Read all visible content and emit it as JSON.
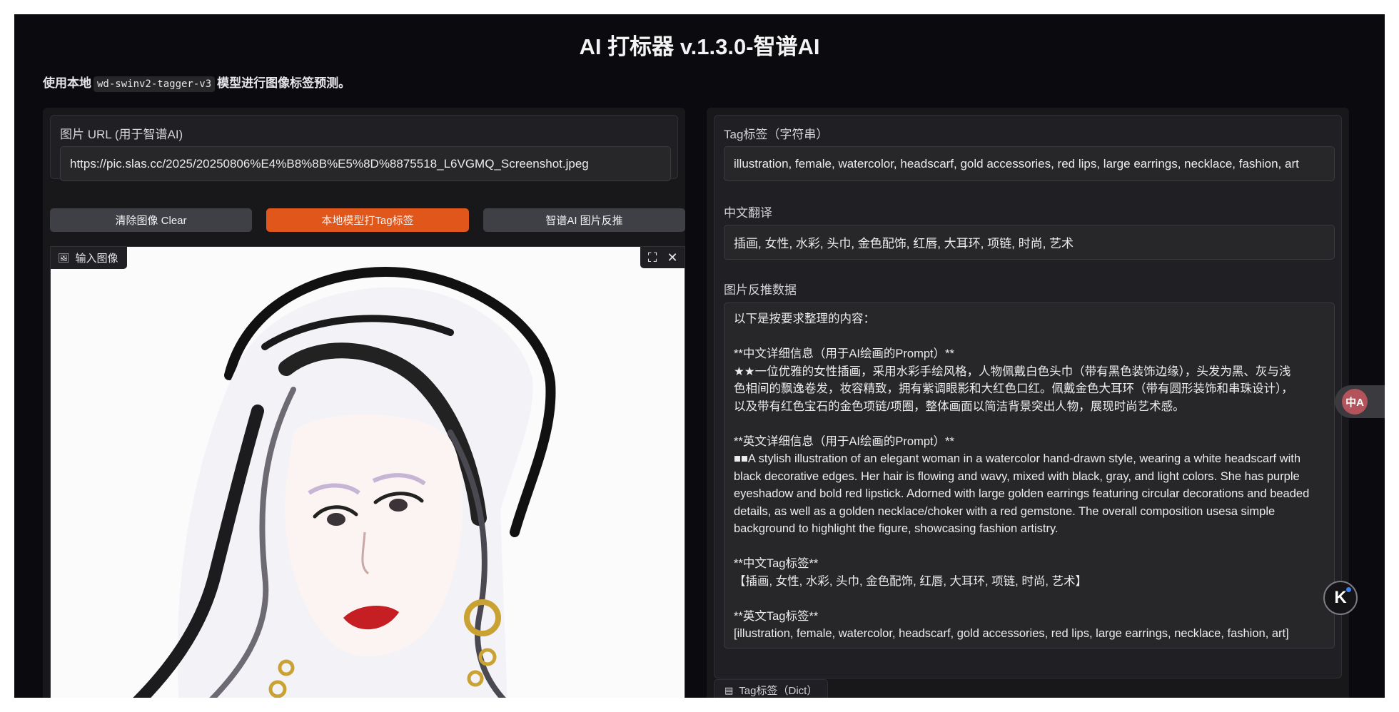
{
  "header": {
    "title": "AI 打标器 v.1.3.0-智谱AI",
    "desc_prefix": "使用本地",
    "desc_model": "wd-swinv2-tagger-v3",
    "desc_suffix": "模型进行图像标签预测。"
  },
  "left": {
    "url_label": "图片 URL (用于智谱AI)",
    "url_value": "https://pic.slas.cc/2025/20250806%E4%B8%8B%E5%8D%8875518_L6VGMQ_Screenshot.jpeg",
    "buttons": {
      "clear": "清除图像 Clear",
      "local_tag": "本地模型打Tag标签",
      "zhipu_reverse": "智谱AI 图片反推"
    },
    "image_label": "输入图像"
  },
  "right": {
    "tag_label": "Tag标签（字符串）",
    "tag_value": "illustration, female, watercolor, headscarf, gold accessories, red lips, large earrings, necklace, fashion, art",
    "cn_label": "中文翻译",
    "cn_value": "插画, 女性, 水彩, 头巾, 金色配饰, 红唇, 大耳环, 项链, 时尚, 艺术",
    "reverse_label": "图片反推数据",
    "reverse_lines": [
      "以下是按要求整理的内容：",
      "",
      "**中文详细信息（用于AI绘画的Prompt）**",
      "★★一位优雅的女性插画，采用水彩手绘风格，人物佩戴白色头巾（带有黑色装饰边缘），头发为黑、灰与浅",
      "色相间的飘逸卷发，妆容精致，拥有紫调眼影和大红色口红。佩戴金色大耳环（带有圆形装饰和串珠设计），",
      "以及带有红色宝石的金色项链/项圈，整体画面以简洁背景突出人物，展现时尚艺术感。",
      "",
      "**英文详细信息（用于AI绘画的Prompt）**",
      "■■A stylish illustration of an elegant woman in a watercolor hand-drawn style, wearing a white headscarf with",
      "black decorative edges. Her hair is flowing and wavy, mixed with black, gray, and light colors. She has purple",
      "eyeshadow and bold red lipstick. Adorned with large golden earrings featuring circular decorations and beaded",
      "details, as well as a golden necklace/choker with a red gemstone. The overall composition usesa simple",
      "background to highlight the figure, showcasing fashion artistry.",
      "",
      "**中文Tag标签**",
      "【插画, 女性, 水彩, 头巾, 金色配饰, 红唇, 大耳环, 项链, 时尚, 艺术】",
      "",
      "**英文Tag标签**",
      "[illustration, female, watercolor, headscarf, gold accessories, red lips, large earrings, necklace, fashion, art]"
    ],
    "dict_label": "Tag标签（Dict）"
  },
  "floating": {
    "translate_icon": "translate-icon",
    "translate_glyph": "中A",
    "k_glyph": "K"
  },
  "colors": {
    "accent": "#e1561a",
    "background": "#0b0b0f",
    "panel": "#18181b"
  }
}
